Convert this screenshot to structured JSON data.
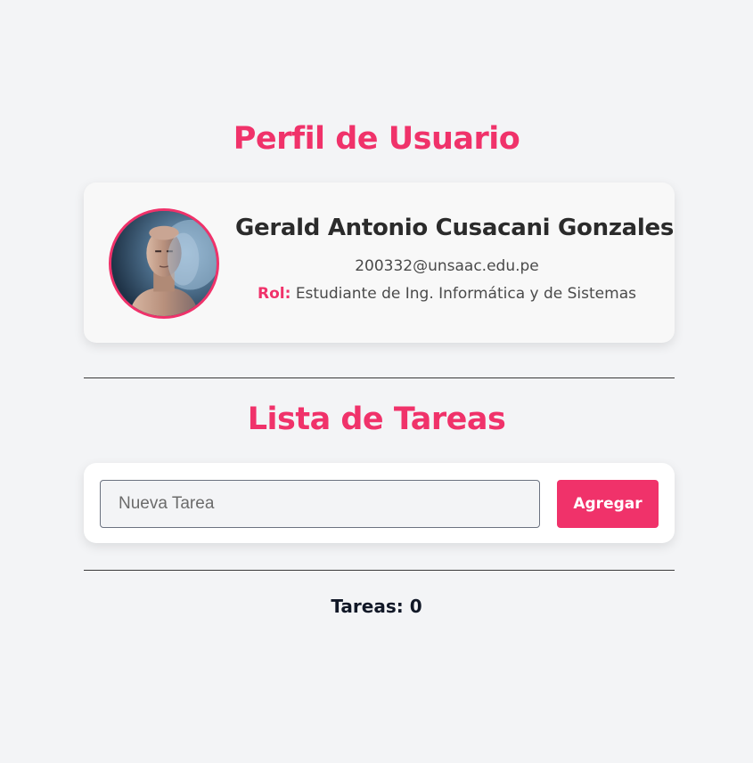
{
  "profile": {
    "section_title": "Perfil de Usuario",
    "name": "Gerald Antonio Cusacani Gonzales",
    "email": "200332@unsaac.edu.pe",
    "role_label": "Rol:",
    "role_value": "Estudiante de Ing. Informática y de Sistemas",
    "avatar_icon": "user-photo"
  },
  "tasks": {
    "section_title": "Lista de Tareas",
    "input_placeholder": "Nueva Tarea",
    "input_value": "",
    "add_button_label": "Agregar",
    "count_label": "Tareas: 0"
  },
  "colors": {
    "accent": "#f0326a",
    "background": "#f3f4f6",
    "card": "#f8f8f8"
  }
}
